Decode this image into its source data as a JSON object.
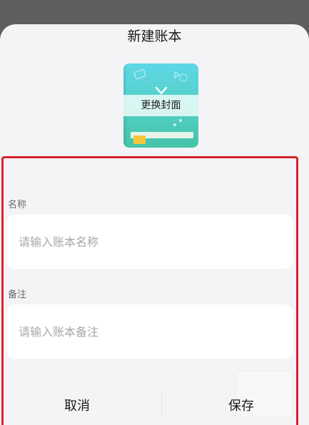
{
  "dialog": {
    "title": "新建账本",
    "cover": {
      "label": "更换封面",
      "colors": {
        "top": "#5fd6e6",
        "bottom": "#45c3a9",
        "accent": "#f5c53b"
      }
    },
    "name": {
      "label": "名称",
      "placeholder": "请输入账本名称",
      "value": ""
    },
    "remark": {
      "label": "备注",
      "placeholder": "请输入账本备注",
      "value": ""
    },
    "actions": {
      "cancel": "取消",
      "save": "保存"
    }
  },
  "theme": {
    "overlay": "#5e5e5e",
    "sheet": "#f4f4f6",
    "highlight_border": "#d9232d"
  }
}
